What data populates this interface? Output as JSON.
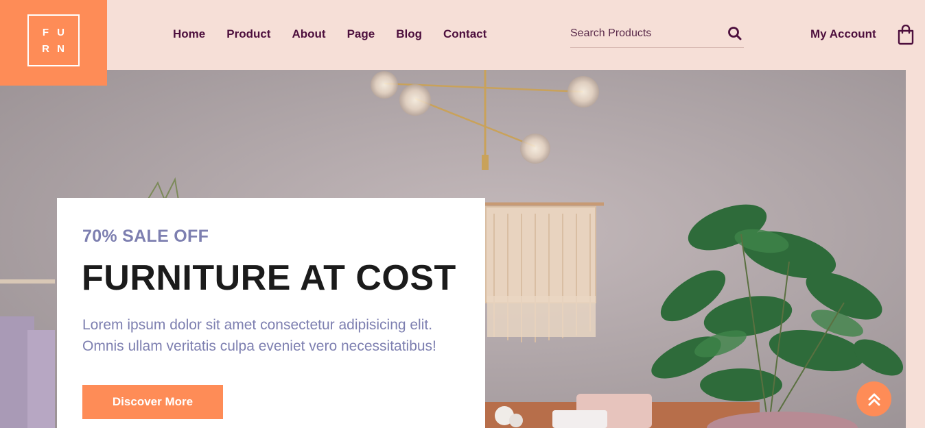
{
  "logo": {
    "letters": [
      "F",
      "U",
      "R",
      "N"
    ]
  },
  "nav": {
    "items": [
      {
        "label": "Home"
      },
      {
        "label": "Product"
      },
      {
        "label": "About"
      },
      {
        "label": "Page"
      },
      {
        "label": "Blog"
      },
      {
        "label": "Contact"
      }
    ]
  },
  "search": {
    "placeholder": "Search Products",
    "icon": "search-icon"
  },
  "account": {
    "label": "My Account"
  },
  "cart": {
    "icon": "shopping-bag-icon"
  },
  "hero": {
    "tag": "70% SALE OFF",
    "title": "FURNITURE AT COST",
    "description": "Lorem ipsum dolor sit amet consectetur adipisicing elit. Omnis ullam veritatis culpa eveniet vero necessitatibus!",
    "button_label": "Discover More"
  },
  "scroll_top": {
    "icon": "double-chevron-up-icon"
  },
  "colors": {
    "accent": "#fe8c57",
    "nav_text": "#4d0f3d",
    "header_bg": "#f6dfd7",
    "muted_text": "#7d7fb0",
    "title_text": "#1b1b1b"
  }
}
